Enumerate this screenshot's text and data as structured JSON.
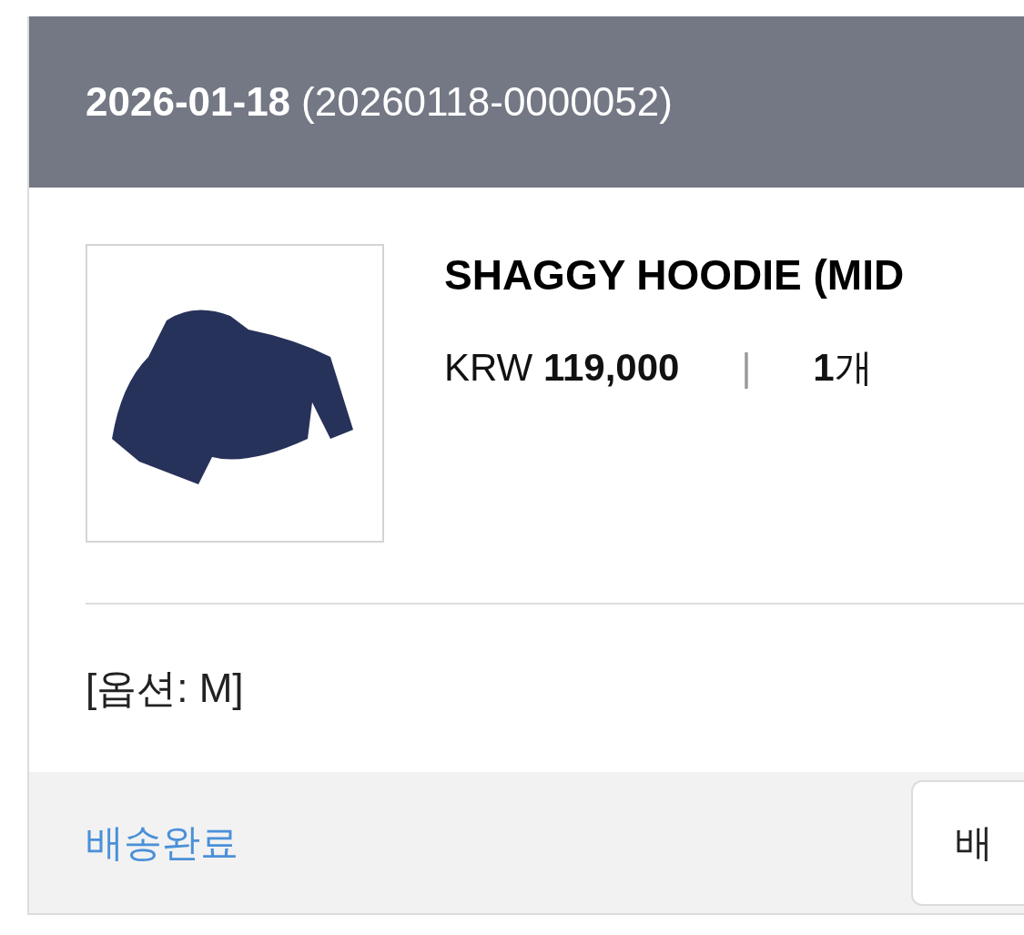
{
  "order": {
    "date": "2026-01-18",
    "order_number": "(20260118-0000052)"
  },
  "product": {
    "name": "SHAGGY HOODIE (MID",
    "price": "KRW **119,000**",
    "separator": "|",
    "quantity": "**1**개",
    "option": "[옵션: M]"
  },
  "footer": {
    "status": "배송완료",
    "button": "배"
  }
}
